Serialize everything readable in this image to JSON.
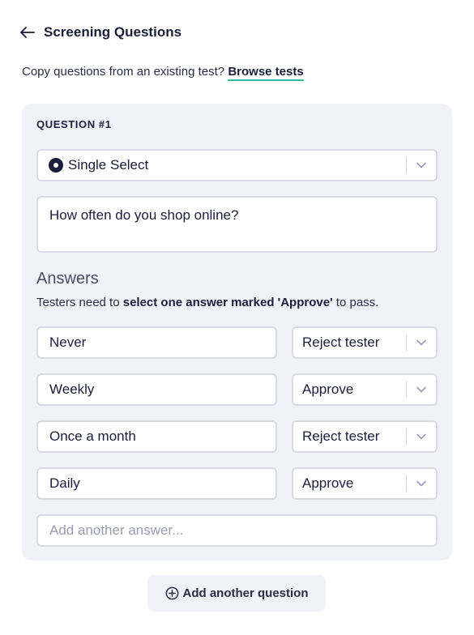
{
  "header": {
    "title": "Screening Questions"
  },
  "copy": {
    "prompt": "Copy questions from an existing test?",
    "link_label": "Browse tests"
  },
  "question": {
    "label": "QUESTION #1",
    "type_label": "Single Select",
    "text": "How often do you shop online?"
  },
  "answers": {
    "title": "Answers",
    "hint_prefix": "Testers need to ",
    "hint_bold": "select one answer marked 'Approve'",
    "hint_suffix": " to pass.",
    "items": [
      {
        "text": "Never",
        "verdict": "Reject tester"
      },
      {
        "text": "Weekly",
        "verdict": "Approve"
      },
      {
        "text": "Once a month",
        "verdict": "Reject tester"
      },
      {
        "text": "Daily",
        "verdict": "Approve"
      }
    ],
    "add_placeholder": "Add another answer..."
  },
  "footer": {
    "add_question_label": "Add another question"
  },
  "colors": {
    "card_bg": "#f1f1fa",
    "text": "#1b1d3a",
    "link_underline": "#2fbfa0",
    "border": "#d9d9e6"
  },
  "icons": {
    "back": "arrow-left-icon",
    "chevron": "chevron-down-icon",
    "radio": "radio-selected-icon",
    "add": "plus-circle-icon"
  }
}
